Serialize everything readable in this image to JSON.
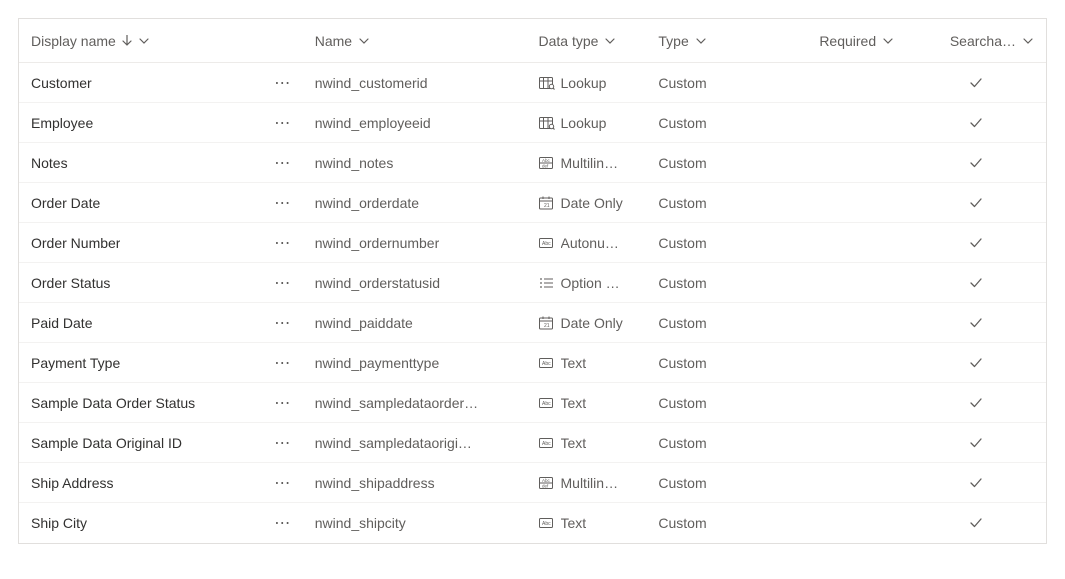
{
  "columns": {
    "display_name": "Display name",
    "name": "Name",
    "data_type": "Data type",
    "type": "Type",
    "required": "Required",
    "searchable": "Searcha…"
  },
  "rows": [
    {
      "display": "Customer",
      "name": "nwind_customerid",
      "datatype_icon": "lookup",
      "datatype": "Lookup",
      "type": "Custom",
      "required": "",
      "searchable": true
    },
    {
      "display": "Employee",
      "name": "nwind_employeeid",
      "datatype_icon": "lookup",
      "datatype": "Lookup",
      "type": "Custom",
      "required": "",
      "searchable": true
    },
    {
      "display": "Notes",
      "name": "nwind_notes",
      "datatype_icon": "multiline",
      "datatype": "Multilin…",
      "type": "Custom",
      "required": "",
      "searchable": true
    },
    {
      "display": "Order Date",
      "name": "nwind_orderdate",
      "datatype_icon": "date",
      "datatype": "Date Only",
      "type": "Custom",
      "required": "",
      "searchable": true
    },
    {
      "display": "Order Number",
      "name": "nwind_ordernumber",
      "datatype_icon": "autonum",
      "datatype": "Autonu…",
      "type": "Custom",
      "required": "",
      "searchable": true
    },
    {
      "display": "Order Status",
      "name": "nwind_orderstatusid",
      "datatype_icon": "option",
      "datatype": "Option …",
      "type": "Custom",
      "required": "",
      "searchable": true
    },
    {
      "display": "Paid Date",
      "name": "nwind_paiddate",
      "datatype_icon": "date",
      "datatype": "Date Only",
      "type": "Custom",
      "required": "",
      "searchable": true
    },
    {
      "display": "Payment Type",
      "name": "nwind_paymenttype",
      "datatype_icon": "text",
      "datatype": "Text",
      "type": "Custom",
      "required": "",
      "searchable": true
    },
    {
      "display": "Sample Data Order Status",
      "name": "nwind_sampledataorder…",
      "datatype_icon": "text",
      "datatype": "Text",
      "type": "Custom",
      "required": "",
      "searchable": true
    },
    {
      "display": "Sample Data Original ID",
      "name": "nwind_sampledataorigi…",
      "datatype_icon": "text",
      "datatype": "Text",
      "type": "Custom",
      "required": "",
      "searchable": true
    },
    {
      "display": "Ship Address",
      "name": "nwind_shipaddress",
      "datatype_icon": "multiline",
      "datatype": "Multilin…",
      "type": "Custom",
      "required": "",
      "searchable": true
    },
    {
      "display": "Ship City",
      "name": "nwind_shipcity",
      "datatype_icon": "text",
      "datatype": "Text",
      "type": "Custom",
      "required": "",
      "searchable": true
    }
  ]
}
